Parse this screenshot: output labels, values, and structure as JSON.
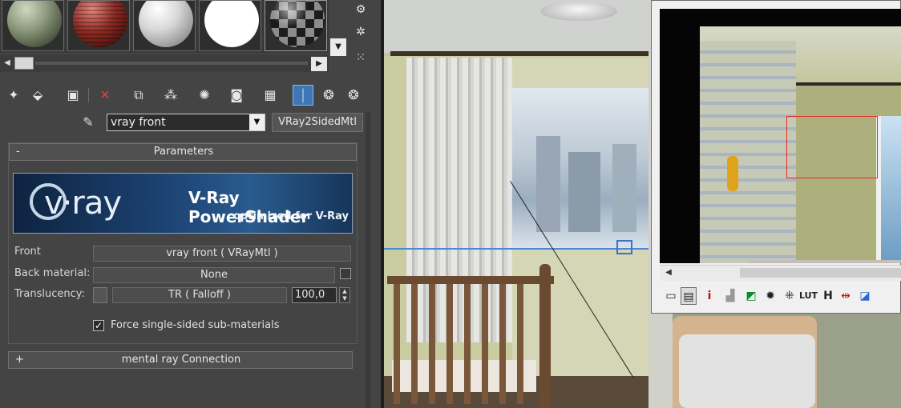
{
  "material_slots": [
    {
      "name": "sphere-stone"
    },
    {
      "name": "sphere-wicker"
    },
    {
      "name": "sphere-white-matte"
    },
    {
      "name": "sphere-white"
    },
    {
      "name": "sphere-checker"
    }
  ],
  "toolbar": {
    "icons": [
      "get-material-icon",
      "put-to-scene-icon",
      "assign-material-icon",
      "delete-icon",
      "make-unique-icon",
      "put-to-library-icon",
      "material-id-icon",
      "show-in-viewport-icon",
      "show-end-result-icon",
      "go-to-parent-icon",
      "go-forward-icon"
    ]
  },
  "material": {
    "name": "vray front",
    "type_button": "VRay2SidedMtl"
  },
  "parameters": {
    "rollout_toggle": "-",
    "rollout_title": "Parameters",
    "banner": {
      "logo": "v·ray",
      "title": "V-Ray PowerShader",
      "subtitle": "optimized for V-Ray"
    },
    "front_label": "Front",
    "front_map": "vray front  ( VRayMtl )",
    "back_label": "Back material:",
    "back_map": "None",
    "translucency_label": "Translucency:",
    "translucency_map": "TR  ( Falloff )",
    "translucency_value": "100,0",
    "force_label": "Force single-sided sub-materials",
    "force_checked": "✓"
  },
  "mental_ray": {
    "toggle": "+",
    "title": "mental ray Connection"
  },
  "render_tools": {
    "labels": [
      "i",
      "LUT",
      "H"
    ]
  }
}
